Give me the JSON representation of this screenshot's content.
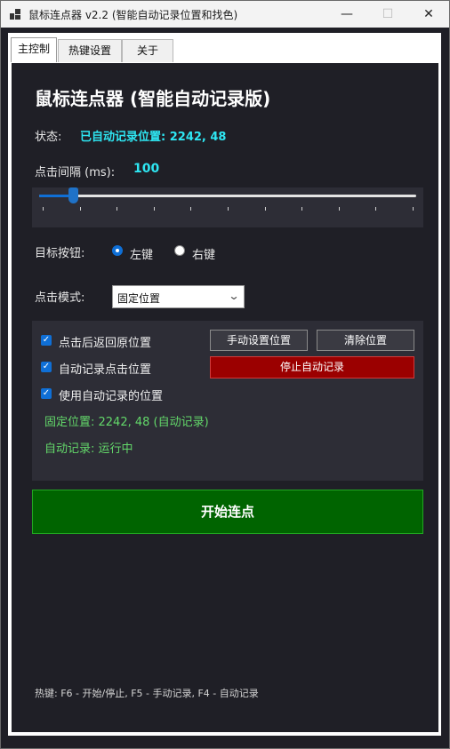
{
  "window": {
    "title": "鼠标连点器 v2.2 (智能自动记录位置和找色)",
    "minimize": "—",
    "maximize": "☐",
    "close": "✕"
  },
  "tabs": [
    {
      "label": "主控制",
      "active": true
    },
    {
      "label": "热键设置",
      "active": false
    },
    {
      "label": "关于",
      "active": false
    }
  ],
  "main": {
    "heading": "鼠标连点器 (智能自动记录版)",
    "status_label": "状态:",
    "status_value": "已自动记录位置: 2242, 48",
    "interval_label": "点击间隔 (ms):",
    "interval_value": "100",
    "slider": {
      "value": 100,
      "min": 10,
      "max": 1000,
      "level": 0.09
    },
    "target_label": "目标按钮:",
    "radio_left": "左键",
    "radio_right": "右键",
    "selected_button": "左键",
    "mode_label": "点击模式:",
    "mode_value": "固定位置",
    "options": {
      "return_pos": "点击后返回原位置",
      "auto_record": "自动记录点击位置",
      "use_recorded": "使用自动记录的位置"
    },
    "buttons": {
      "manual_set": "手动设置位置",
      "clear": "清除位置",
      "stop_record": "停止自动记录"
    },
    "fixed_pos_text": "固定位置: 2242, 48 (自动记录)",
    "auto_record_text": "自动记录: 运行中",
    "start_button": "开始连点",
    "hotkeys": "热键: F6 - 开始/停止, F5 - 手动记录, F4 - 自动记录"
  },
  "colors": {
    "background": "#1f1f26",
    "accent_cyan": "#2ee6f2",
    "accent_blue": "#0f6fd6",
    "start_green": "#006400",
    "stop_red": "#9b0000",
    "status_green": "#63d86a"
  }
}
